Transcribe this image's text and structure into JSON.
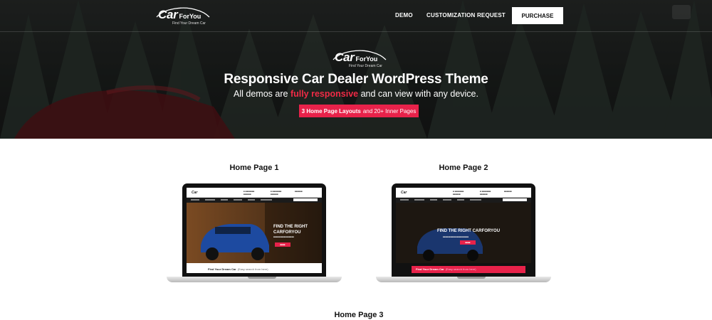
{
  "header": {
    "logo": {
      "car": "Car",
      "for_you": "ForYou",
      "tagline": "Find Your Dream Car"
    },
    "nav": [
      "DEMO",
      "CUSTOMIZATION REQUEST"
    ],
    "purchase_label": "PURCHASE"
  },
  "hero": {
    "title": "Responsive Car Dealer WordPress Theme",
    "subtitle_before": "All demos are ",
    "subtitle_highlight": "fully responsive",
    "subtitle_after": " and can view with any device.",
    "badge_bold": "3 Home Page Layouts",
    "badge_rest": "and 20+ Inner Pages"
  },
  "demos": [
    {
      "label": "Home Page 1",
      "screen": {
        "headline": "FIND THE RIGHT CARFORYOU",
        "footer_bold": "Find Your Dream Car",
        "footer_rest": "(Easy search from here)"
      }
    },
    {
      "label": "Home Page 2",
      "screen": {
        "headline": "FIND THE RIGHT CARFORYOU",
        "footer_bold": "Find Your Dream Car",
        "footer_rest": "(Easy search from here)"
      }
    },
    {
      "label": "Home Page 3"
    }
  ],
  "colors": {
    "accent": "#e8224a",
    "highlight": "#f02b46",
    "hero_bg": "#1b1f1d"
  }
}
